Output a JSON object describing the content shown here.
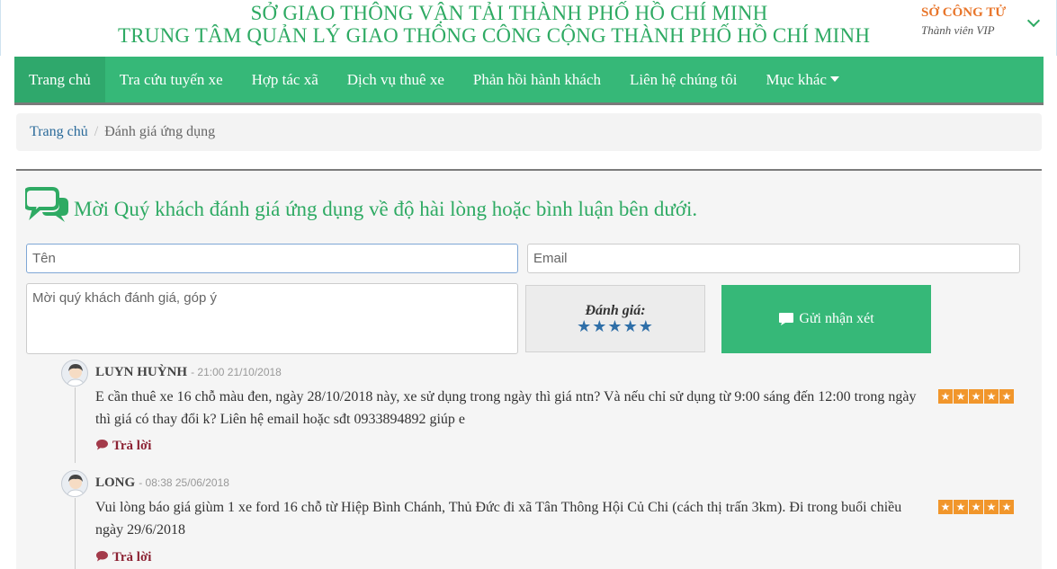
{
  "header": {
    "org_line1": "SỞ GIAO THÔNG VẬN TẢI THÀNH PHỐ HỒ CHÍ MINH",
    "org_line2": "TRUNG TÂM QUẢN LÝ GIAO THÔNG CÔNG CỘNG THÀNH PHỐ HỒ CHÍ MINH",
    "user_name": "SỞ CÔNG TỬ",
    "user_role": "Thành viên VIP"
  },
  "nav": {
    "items": [
      {
        "label": "Trang chủ"
      },
      {
        "label": "Tra cứu tuyến xe"
      },
      {
        "label": "Hợp tác xã"
      },
      {
        "label": "Dịch vụ thuê xe"
      },
      {
        "label": "Phản hồi hành khách"
      },
      {
        "label": "Liên hệ chúng tôi"
      },
      {
        "label": "Mục khác"
      }
    ]
  },
  "breadcrumb": {
    "home": "Trang chủ",
    "current": "Đánh giá ứng dụng"
  },
  "feedback": {
    "title": "Mời Quý khách đánh giá ứng dụng về độ hài lòng hoặc bình luận bên dưới.",
    "name_placeholder": "Tên",
    "email_placeholder": "Email",
    "comment_placeholder": "Mời quý khách đánh giá, góp ý",
    "rating_label": "Đánh giá:",
    "rating_stars": "★★★★★",
    "rating_value": 5,
    "submit_label": "Gửi nhận xét"
  },
  "comments": [
    {
      "author": "LUYN HUỲNH",
      "time": "- 21:00 21/10/2018",
      "text": "E cần thuê xe 16 chỗ màu đen, ngày 28/10/2018 này, xe sử dụng trong ngày thì giá ntn? Và nếu chỉ sử dụng từ 9:00 sáng đến 12:00 trong ngày thì giá có thay đổi k? Liên hệ email hoặc sđt 0933894892 giúp e",
      "rating": 5,
      "reply_label": "Trả lời"
    },
    {
      "author": "LONG",
      "time": "- 08:38 25/06/2018",
      "text": "Vui lòng báo giá giùm 1 xe ford 16 chỗ từ Hiệp Bình Chánh, Thủ Đức đi xã Tân Thông Hội Củ Chi (cách thị trấn 3km). Đi trong buổi chiều ngày 29/6/2018",
      "rating": 5,
      "reply_label": "Trả lời"
    }
  ],
  "colors": {
    "brand_green": "#36b878",
    "title_green": "#2eaa63",
    "user_orange": "#e8752a",
    "star_orange": "#f1962b",
    "reply_red": "#8c2233",
    "rating_blue": "#2f6fa8"
  }
}
